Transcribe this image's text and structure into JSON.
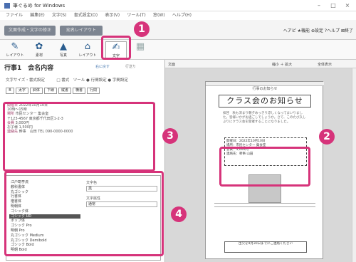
{
  "window": {
    "title": "筆ぐるめ for Windows",
    "minimize": "–",
    "maximize": "□",
    "close": "×"
  },
  "menu": [
    "ファイル",
    "編集(E)",
    "文字(S)",
    "書式設定(O)",
    "表示(V)",
    "ツール(T)",
    "窓(W)",
    "ヘルプ(H)"
  ],
  "tabs": [
    {
      "label": "文面作成・文字の修正"
    },
    {
      "label": "宛名レイアウト"
    }
  ],
  "right_menu": "ヘアピ ★機能 ⊕設定 ?ヘルプ ⊠終了",
  "toolbar": [
    {
      "icon": "brush-icon",
      "label": "レイアウト"
    },
    {
      "icon": "stamp-icon",
      "label": "素材"
    },
    {
      "icon": "image-icon",
      "label": "写真"
    },
    {
      "icon": "frame-icon",
      "label": "レイアウト"
    },
    {
      "icon": "text-icon",
      "label": "文字"
    },
    {
      "icon": "grid-icon",
      "label": ""
    }
  ],
  "left_panel": {
    "title": "行事1　会名内容",
    "link1": "右に戻す",
    "link2": "行送り",
    "row1": "文字サイズ・書式設定　　　□ 書式　ツール ● 行間設定 ● 字間設定",
    "buttons": [
      "B",
      "太字",
      "斜体",
      "下線",
      "縦書",
      "横書",
      "行間"
    ],
    "text_lines": [
      {
        "label": "開催日",
        "value": "2022年10月10日"
      },
      {
        "label": "",
        "value": "10時〜15時"
      },
      {
        "label": "場所",
        "value": "市民センター 集会室"
      },
      {
        "label": "",
        "value": "〒123-4567 東京都千代田区1-2-3"
      },
      {
        "label": "会費",
        "value": "3,000円"
      },
      {
        "label": "",
        "value": "お子様 1,500円"
      },
      {
        "label": "連絡先",
        "value": "幹事　山田 TEL 090-0000-0000"
      }
    ],
    "fonts": [
      "江戸勘亭流",
      "教科書体",
      "丸ゴシック",
      "行書体",
      "楷書体",
      "明朝体",
      "ゴシック体",
      "ゴシック UD",
      "ポップ体",
      "ゴシック Pro",
      "明朝 Pro",
      "丸ゴシック Medium",
      "丸ゴシック Demibold",
      "ゴシック Bold",
      "明朝 Bold"
    ],
    "fonts_selected_index": 7,
    "font_color_label": "文字色",
    "font_color_value": "黒",
    "font_size_label": "文字属性",
    "font_size_value": "通常"
  },
  "canvas": {
    "header_left": "文面",
    "header_mid": "縮小 ＋ 拡大",
    "header_right": "全体表示",
    "paper_header": "行事のお知らせ",
    "paper_title": "クラス会のお知らせ",
    "paper_body": "拝啓　秋も深まり朝夕めっきり涼しくなってまいりました。皆様いかがお過ごしでしょうか。さて、このたび久しぶりにクラス会を開催することになりました。",
    "event_lines": [
      "開催日：2022年10月10日",
      "場所：市民センター 集会室",
      "会費：3,000円",
      "連絡先：幹事 山田"
    ],
    "footnote": "出欠を9月30日までにご連絡ください"
  },
  "callouts": [
    "1",
    "2",
    "3",
    "4"
  ]
}
